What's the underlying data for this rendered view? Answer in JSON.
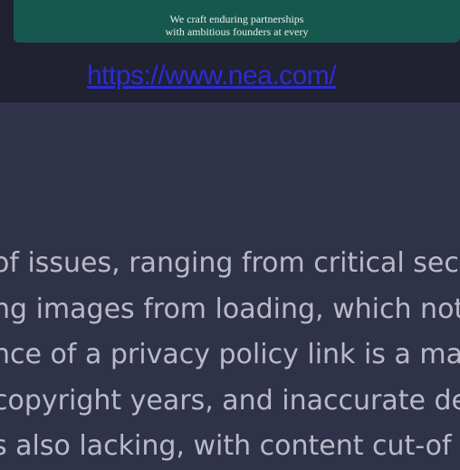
{
  "preview": {
    "tagline_line1": "We craft enduring partnerships",
    "tagline_line2": "with ambitious founders at every"
  },
  "link": {
    "text": "https://www.nea.com/"
  },
  "report": {
    "lines": [
      "of issues, ranging from critical sec",
      "ng images from loading, which not",
      "nce of a privacy policy link is a ma",
      "copyright years, and inaccurate de",
      "s also lacking, with content cut-of"
    ]
  }
}
